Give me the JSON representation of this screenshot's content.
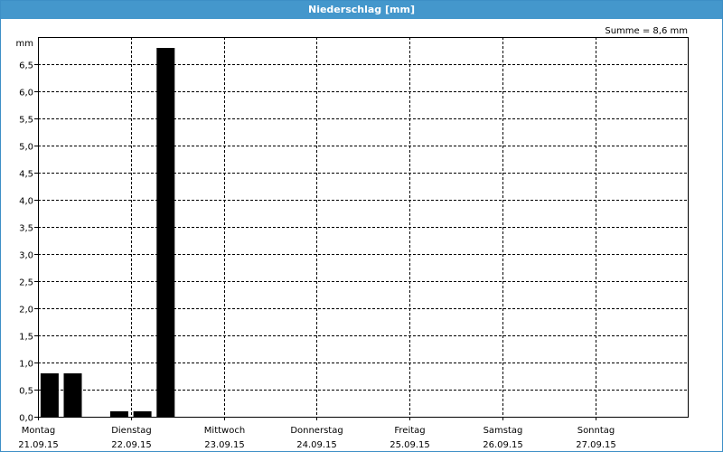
{
  "window": {
    "title": "Niederschlag [mm]"
  },
  "chart_data": {
    "type": "bar",
    "ylabel": "mm",
    "annotation": "Summe = 8,6 mm",
    "ylim": [
      0,
      7.0
    ],
    "yticks": [
      "0,0",
      "0,5",
      "1,0",
      "1,5",
      "2,0",
      "2,5",
      "3,0",
      "3,5",
      "4,0",
      "4,5",
      "5,0",
      "5,5",
      "6,0",
      "6,5"
    ],
    "days": [
      {
        "name": "Montag",
        "date": "21.09.15"
      },
      {
        "name": "Dienstag",
        "date": "22.09.15"
      },
      {
        "name": "Mittwoch",
        "date": "23.09.15"
      },
      {
        "name": "Donnerstag",
        "date": "24.09.15"
      },
      {
        "name": "Freitag",
        "date": "25.09.15"
      },
      {
        "name": "Samstag",
        "date": "26.09.15"
      },
      {
        "name": "Sonntag",
        "date": "27.09.15"
      }
    ],
    "interval_hours": 6,
    "series": [
      {
        "values": [
          0.8,
          0.8,
          0.0,
          0.1,
          0.1,
          6.8,
          0.0,
          0.0,
          0.0,
          0.0,
          0.0,
          0.0,
          0.0,
          0.0,
          0.0,
          0.0,
          0.0,
          0.0,
          0.0,
          0.0,
          0.0,
          0.0,
          0.0,
          0.0,
          0.0,
          0.0,
          0.0,
          0.0
        ]
      }
    ],
    "bar_color": "#000000",
    "grid": true,
    "title_bar_color": "#4497cc"
  }
}
